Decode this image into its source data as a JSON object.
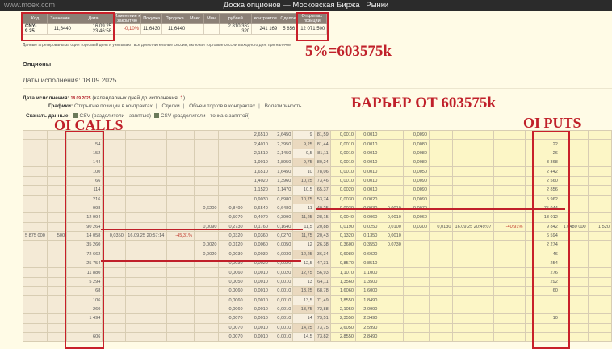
{
  "topbar": {
    "url": "www.moex.com",
    "title": "Доска опционов — Московская Биржа | Рынки"
  },
  "summary": {
    "headers": [
      "Код",
      "Значение",
      "Дата",
      "Изменение к закрытию",
      "Покупка",
      "Продажа",
      "Макс.",
      "Мин.",
      "рублей",
      "контрактов",
      "Сделок",
      "Открытых позиций"
    ],
    "values": [
      "CNY-9.25",
      "11,6440",
      "16.09.25 23:46:58",
      "-0,10%",
      "11,6430",
      "11,6440",
      "",
      "",
      "2 810 362 320",
      "241 169",
      "5 856",
      "12 071 500"
    ]
  },
  "note": "Данные агрегированы за один торговый день и учитывают все дополнительные сессии, включая торговые сессии выходного дня, при наличии",
  "section_title": "Опционы",
  "expiry_dates": "Даты исполнения: 18.09.2025",
  "expiry": {
    "label": "Дата исполнения:",
    "date": "18.09.2025",
    "days_label": "(календарных дней до исполнения:",
    "days": "1",
    "close": ")"
  },
  "charts": {
    "label": "Графики:",
    "links": [
      "Открытые позиции в контрактах",
      "Сделки",
      "Объем торгов в контрактах",
      "Волатильность"
    ]
  },
  "download": {
    "label": "Скачать данные:",
    "links": [
      "CSV (разделители - запятые)",
      "CSV (разделители - точка с запятой)"
    ]
  },
  "annotations": {
    "five_percent": "5%=603575k",
    "barrier": "БАРЬЕР ОТ 603575k",
    "oi_calls": "OI CALLS",
    "oi_puts": "OI PUTS"
  },
  "colors": {
    "accent": "#c0202a",
    "header": "#8b8076",
    "calls_bg": "#f4ead6",
    "puts_bg": "#fcf6c6"
  },
  "rows": [
    [
      "",
      "",
      "",
      "",
      "",
      "",
      "",
      "",
      "2,6510",
      "2,6450",
      "9",
      "81,59",
      "0,0010",
      "0,0010",
      "",
      "0,0090",
      "",
      "",
      "",
      "",
      "",
      ""
    ],
    [
      "",
      "",
      "54",
      "",
      "",
      "",
      "",
      "",
      "2,4010",
      "2,3950",
      "9,25",
      "81,44",
      "0,0010",
      "0,0010",
      "",
      "0,0080",
      "",
      "",
      "",
      "22",
      "",
      ""
    ],
    [
      "",
      "",
      "152",
      "",
      "",
      "",
      "",
      "",
      "2,1510",
      "2,1450",
      "9,5",
      "81,11",
      "0,0010",
      "0,0010",
      "",
      "0,0080",
      "",
      "",
      "",
      "26",
      "",
      ""
    ],
    [
      "",
      "",
      "144",
      "",
      "",
      "",
      "",
      "",
      "1,9010",
      "1,8950",
      "9,75",
      "80,24",
      "0,0010",
      "0,0010",
      "",
      "0,0080",
      "",
      "",
      "",
      "3 368",
      "",
      ""
    ],
    [
      "",
      "",
      "100",
      "",
      "",
      "",
      "",
      "",
      "1,6510",
      "1,6450",
      "10",
      "78,06",
      "0,0010",
      "0,0010",
      "",
      "0,0050",
      "",
      "",
      "",
      "2 442",
      "",
      ""
    ],
    [
      "",
      "",
      "66",
      "",
      "",
      "",
      "",
      "",
      "1,4020",
      "1,3960",
      "10,25",
      "73,46",
      "0,0010",
      "0,0010",
      "",
      "0,0090",
      "",
      "",
      "",
      "2 560",
      "",
      ""
    ],
    [
      "",
      "",
      "114",
      "",
      "",
      "",
      "",
      "",
      "1,1520",
      "1,1470",
      "10,5",
      "65,37",
      "0,0020",
      "0,0010",
      "",
      "0,0090",
      "",
      "",
      "",
      "2 856",
      "",
      ""
    ],
    [
      "",
      "",
      "216",
      "",
      "",
      "",
      "",
      "",
      "0,9030",
      "0,8980",
      "10,75",
      "53,74",
      "0,0030",
      "0,0020",
      "",
      "0,0090",
      "",
      "",
      "",
      "5 962",
      "",
      ""
    ],
    [
      "",
      "",
      "998",
      "",
      "",
      "",
      "0,6200",
      "0,8490",
      "0,6540",
      "0,6480",
      "11",
      "40,25",
      "0,0030",
      "0,0030",
      "0,0010",
      "0,0070",
      "",
      "",
      "",
      "75 944",
      "",
      ""
    ],
    [
      "",
      "",
      "12 994",
      "",
      "",
      "",
      "",
      "0,5070",
      "0,4070",
      "0,3990",
      "11,25",
      "28,15",
      "0,0040",
      "0,0060",
      "0,0010",
      "0,0060",
      "",
      "",
      "",
      "13 012",
      "",
      ""
    ],
    [
      "",
      "",
      "90 264",
      "",
      "",
      "",
      "0,0090",
      "0,2730",
      "0,1760",
      "0,1640",
      "11,5",
      "20,88",
      "0,0190",
      "0,0250",
      "0,0100",
      "0,0300",
      "0,0130",
      "16.09.25 20:49:07",
      "-40,91%",
      "9 842",
      "17 480 000",
      "1 520"
    ],
    [
      "5 875 000",
      "500",
      "14 058",
      "0,0350",
      "16.09.25 20:57:14",
      "-45,31%",
      "",
      "0,0320",
      "0,0360",
      "0,0270",
      "11,75",
      "20,43",
      "0,1320",
      "0,1350",
      "0,0010",
      "",
      "",
      "",
      "",
      "6 594",
      "",
      ""
    ],
    [
      "",
      "",
      "35 260",
      "",
      "",
      "",
      "0,0020",
      "0,0120",
      "0,0060",
      "0,0050",
      "12",
      "26,38",
      "0,3600",
      "0,3550",
      "0,0730",
      "",
      "",
      "",
      "",
      "2 274",
      "",
      ""
    ],
    [
      "",
      "",
      "72 662",
      "",
      "",
      "",
      "0,0020",
      "0,0030",
      "0,0030",
      "0,0030",
      "12,25",
      "36,34",
      "0,6080",
      "0,6020",
      "",
      "",
      "",
      "",
      "",
      "46",
      "",
      ""
    ],
    [
      "",
      "",
      "25 754",
      "",
      "",
      "",
      "",
      "0,0030",
      "0,0020",
      "0,0020",
      "12,5",
      "47,31",
      "0,8570",
      "0,8510",
      "",
      "",
      "",
      "",
      "",
      "254",
      "",
      ""
    ],
    [
      "",
      "",
      "11 880",
      "",
      "",
      "",
      "",
      "0,0060",
      "0,0010",
      "0,0020",
      "12,75",
      "56,93",
      "1,1070",
      "1,1000",
      "",
      "",
      "",
      "",
      "",
      "276",
      "",
      ""
    ],
    [
      "",
      "",
      "5 294",
      "",
      "",
      "",
      "",
      "0,0050",
      "0,0010",
      "0,0010",
      "13",
      "64,11",
      "1,3560",
      "1,3500",
      "",
      "",
      "",
      "",
      "",
      "292",
      "",
      ""
    ],
    [
      "",
      "",
      "68",
      "",
      "",
      "",
      "",
      "0,0060",
      "0,0010",
      "0,0010",
      "13,25",
      "68,78",
      "1,6060",
      "1,6000",
      "",
      "",
      "",
      "",
      "",
      "60",
      "",
      ""
    ],
    [
      "",
      "",
      "106",
      "",
      "",
      "",
      "",
      "0,0060",
      "0,0010",
      "0,0010",
      "13,5",
      "71,49",
      "1,8550",
      "1,8490",
      "",
      "",
      "",
      "",
      "",
      "",
      "",
      ""
    ],
    [
      "",
      "",
      "260",
      "",
      "",
      "",
      "",
      "0,0060",
      "0,0010",
      "0,0010",
      "13,75",
      "72,88",
      "2,1050",
      "2,0990",
      "",
      "",
      "",
      "",
      "",
      "",
      "",
      ""
    ],
    [
      "",
      "",
      "1 494",
      "",
      "",
      "",
      "",
      "0,0070",
      "0,0010",
      "0,0010",
      "14",
      "73,51",
      "2,3550",
      "2,3490",
      "",
      "",
      "",
      "",
      "",
      "10",
      "",
      ""
    ],
    [
      "",
      "",
      "",
      "",
      "",
      "",
      "",
      "0,0070",
      "0,0010",
      "0,0010",
      "14,25",
      "73,75",
      "2,6050",
      "2,5990",
      "",
      "",
      "",
      "",
      "",
      "",
      "",
      ""
    ],
    [
      "",
      "",
      "606",
      "",
      "",
      "",
      "",
      "0,0070",
      "0,0010",
      "0,0010",
      "14,5",
      "73,82",
      "2,8550",
      "2,8490",
      "",
      "",
      "",
      "",
      "",
      "",
      "",
      ""
    ]
  ]
}
